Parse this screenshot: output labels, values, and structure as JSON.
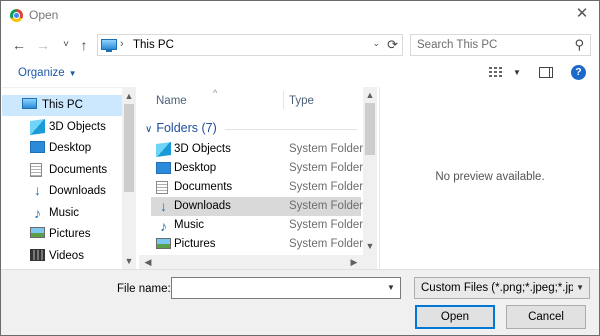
{
  "window": {
    "title": "Open",
    "close": "✕"
  },
  "nav": {
    "back": "←",
    "forward": "→",
    "recent": "˅",
    "up": "↑",
    "address_sep": "›",
    "address": "This PC",
    "address_dropdown": "⌄",
    "refresh": "⟳",
    "search_placeholder": "Search This PC",
    "search_icon": "⚲"
  },
  "toolbar": {
    "organize": "Organize",
    "organize_caret": "▼",
    "view_caret": "▼",
    "help": "?"
  },
  "sidebar": {
    "scroll_up": "▲",
    "scroll_down": "▼",
    "items": [
      {
        "label": "This PC",
        "icon": "pc-icon",
        "selected": true
      },
      {
        "label": "3D Objects",
        "icon": "cube-icon"
      },
      {
        "label": "Desktop",
        "icon": "desktop-icon"
      },
      {
        "label": "Documents",
        "icon": "documents-icon"
      },
      {
        "label": "Downloads",
        "icon": "download-icon"
      },
      {
        "label": "Music",
        "icon": "music-icon"
      },
      {
        "label": "Pictures",
        "icon": "pictures-icon"
      },
      {
        "label": "Videos",
        "icon": "videos-icon"
      }
    ]
  },
  "filelist": {
    "columns": {
      "name": "Name",
      "type": "Type",
      "sort_glyph": "^"
    },
    "group": {
      "chevron": "∨",
      "label": "Folders (7)"
    },
    "rows": [
      {
        "name": "3D Objects",
        "type": "System Folder",
        "icon": "cube-icon"
      },
      {
        "name": "Desktop",
        "type": "System Folder",
        "icon": "desktop-icon"
      },
      {
        "name": "Documents",
        "type": "System Folder",
        "icon": "documents-icon"
      },
      {
        "name": "Downloads",
        "type": "System Folder",
        "icon": "download-icon",
        "selected": true
      },
      {
        "name": "Music",
        "type": "System Folder",
        "icon": "music-icon"
      },
      {
        "name": "Pictures",
        "type": "System Folder",
        "icon": "pictures-icon"
      }
    ],
    "scroll_up": "▲",
    "scroll_down": "▼",
    "scroll_left": "◀",
    "scroll_right": "▶"
  },
  "preview": {
    "message": "No preview available."
  },
  "bottom": {
    "filename_label": "File name:",
    "filename_value": "",
    "filename_dropdown": "▼",
    "filter": "Custom Files (*.png;*.jpeg;*.jpg",
    "filter_dropdown": "▼",
    "open": "Open",
    "cancel": "Cancel"
  }
}
